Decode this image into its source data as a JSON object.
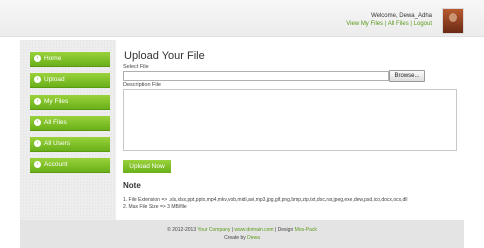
{
  "header": {
    "welcome_text": "Welcome, Dewa_Adha",
    "links": [
      "View My Files",
      "All Files",
      "Logout"
    ],
    "separator": " | "
  },
  "sidebar": {
    "items": [
      {
        "label": "Home"
      },
      {
        "label": "Upload"
      },
      {
        "label": "My Files"
      },
      {
        "label": "All Files"
      },
      {
        "label": "All Users"
      },
      {
        "label": "Account"
      }
    ]
  },
  "main": {
    "title": "Upload Your File",
    "select_label": "Select File",
    "file_value": "",
    "browse_label": "Browse...",
    "description_label": "Description File",
    "description_value": "",
    "upload_button": "Upload Now",
    "note_title": "Note",
    "notes": [
      "1. File Extension => .xls,xlsx,ppt,pptx,mp4,mkv,vob,midi,avi,mp3,jpg,gif,png,bmp,zip,txt,doc,rar,jpeg,exe,dew,psd,ico,docx,ocx,dll",
      "2. Max File Size => 3 MB/file"
    ]
  },
  "footer": {
    "copyright": "© 2012-2013",
    "company": "Your Company",
    "sep1": " | ",
    "domain": "www.domain.com",
    "design_text": " | Design",
    "designer": "Mos-Pack",
    "created_by": "Create by",
    "author": "Dewa"
  },
  "colors": {
    "accent_green": "#6ab01a",
    "link_green": "#5a9a1a"
  }
}
